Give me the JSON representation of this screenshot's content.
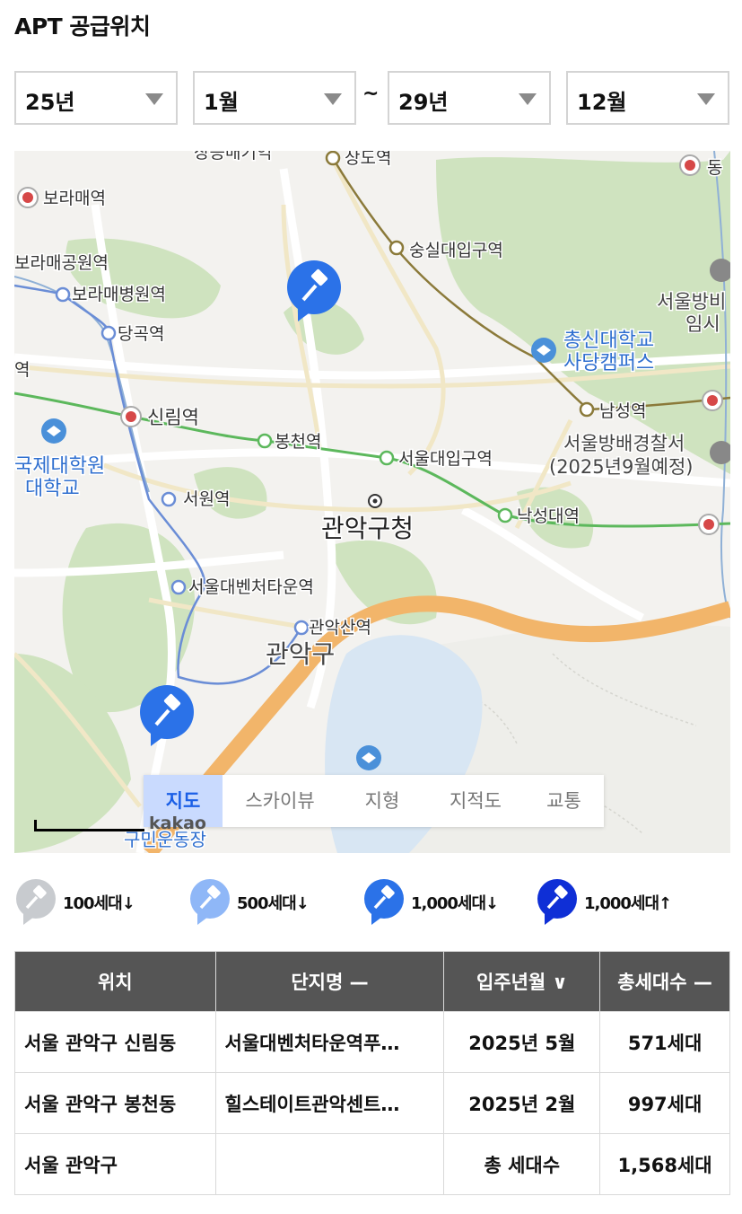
{
  "header": {
    "title": "APT 공급위치"
  },
  "filters": {
    "start_year": "25년",
    "start_month": "1월",
    "separator": "~",
    "end_year": "29년",
    "end_month": "12월"
  },
  "map": {
    "labels": {
      "boramae": "보라매역",
      "boramae_park": "보라매공원역",
      "boramae_hospital": "보라매병원역",
      "danggok": "당곡역",
      "sillim": "신림역",
      "bongcheon": "봉천역",
      "seoul_univ_entrance": "서울대입구역",
      "seowon": "서원역",
      "gwanak_office": "관악구청",
      "venture_town": "서울대벤처타운역",
      "gwanaksan": "관악산역",
      "gwanak_gu": "관악구",
      "nakseongdae": "낙성대역",
      "soongsil": "숭실대입구역",
      "jangseungbaegi": "장승배기역",
      "sangdo": "상도역",
      "namseong": "남성역",
      "chongshin_1": "총신대학교",
      "chongshin_2": "사당캠퍼스",
      "police_1": "서울방배경찰서",
      "police_2": "(2025년9월예정)",
      "right_top_1": "서울방비",
      "right_top_2": "임시",
      "intl_1": "국제대학원",
      "intl_2": "대학교",
      "dong": "동",
      "bottom": "구민운동장",
      "station_left": "역"
    },
    "tabs": [
      "지도",
      "스카이뷰",
      "지형",
      "지적도",
      "교통"
    ],
    "active_tab": "지도",
    "scale_text": "kakao"
  },
  "legend": [
    {
      "label": "100세대↓",
      "color": "#c8cbcf"
    },
    {
      "label": "500세대↓",
      "color": "#8fb7f7"
    },
    {
      "label": "1,000세대↓",
      "color": "#2b72e8"
    },
    {
      "label": "1,000세대↑",
      "color": "#0f2fd6"
    }
  ],
  "table": {
    "headers": [
      "위치",
      "단지명 —",
      "입주년월 ∨",
      "총세대수 —"
    ],
    "rows": [
      [
        "서울 관악구 신림동",
        "서울대벤처타운역푸…",
        "2025년 5월",
        "571세대"
      ],
      [
        "서울 관악구 봉천동",
        "힐스테이트관악센트…",
        "2025년 2월",
        "997세대"
      ],
      [
        "서울 관악구",
        "",
        "총 세대수",
        "1,568세대"
      ]
    ]
  }
}
